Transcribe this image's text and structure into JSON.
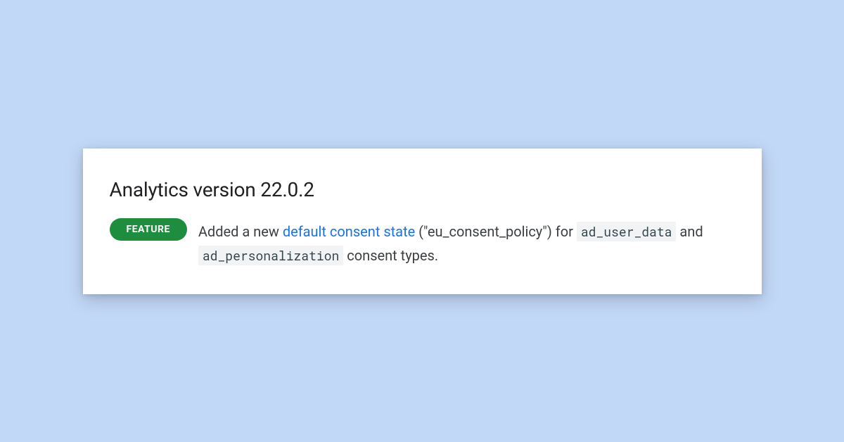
{
  "card": {
    "heading": "Analytics version 22.0.2",
    "badge": "FEATURE",
    "description": {
      "text_before_link": "Added a new ",
      "link_text": "default consent state",
      "text_after_link": " (\"eu_consent_policy\") for ",
      "code1": "ad_user_data",
      "text_mid": " and ",
      "code2": "ad_personalization",
      "text_end": " consent types."
    }
  }
}
